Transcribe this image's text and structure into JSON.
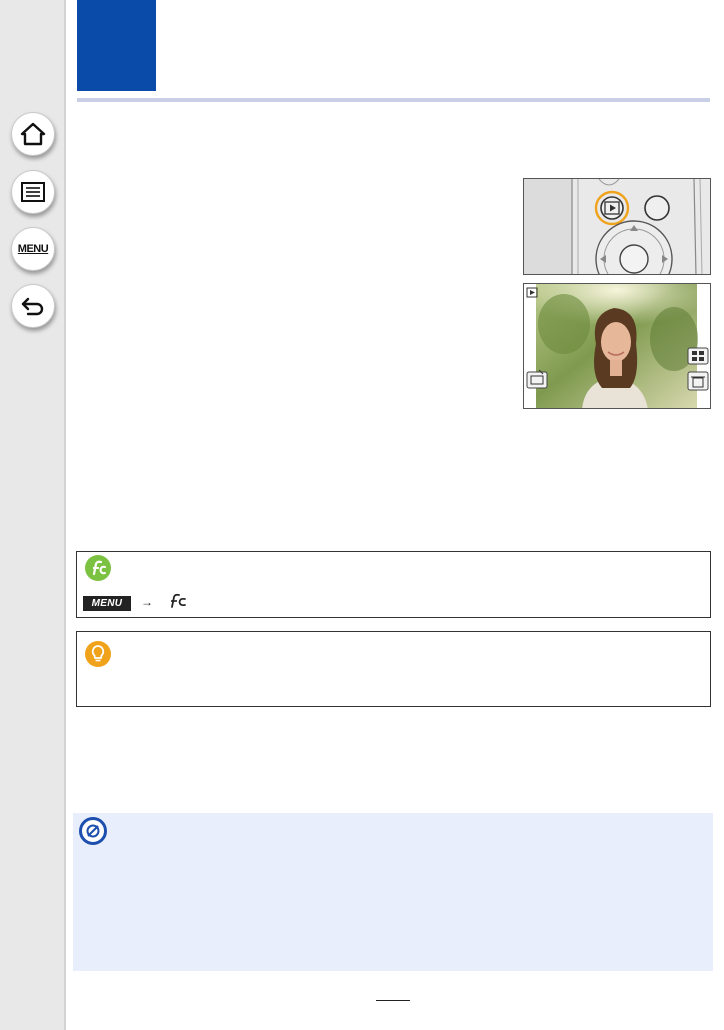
{
  "sidebar": {
    "items": [
      {
        "icon": "home-icon"
      },
      {
        "icon": "contents-list-icon"
      },
      {
        "icon": "menu-icon",
        "label": "MENU"
      },
      {
        "icon": "back-arrow-icon"
      }
    ]
  },
  "chapter": {
    "color": "#0a4aa8"
  },
  "custom_box": {
    "icon": "custom-menu-icon",
    "menu_badge": "MENU",
    "icon_color": "#7cc242"
  },
  "tip_box": {
    "icon": "lightbulb-icon",
    "icon_color": "#f0a21a"
  },
  "note_box": {
    "icon": "not-available-icon",
    "icon_color": "#1c4fae"
  },
  "images": [
    {
      "name": "camera-playback-button-photo"
    },
    {
      "name": "playback-screen-photo"
    }
  ]
}
